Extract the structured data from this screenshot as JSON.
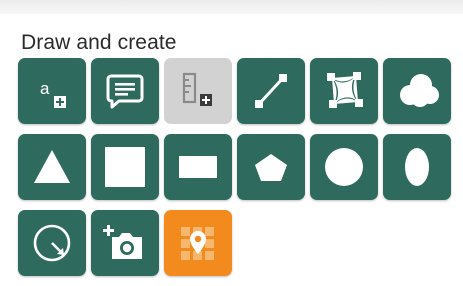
{
  "panel": {
    "title": "Draw and create"
  },
  "colors": {
    "tile": "#2e6b5e",
    "tile_disabled": "#d2d2d2",
    "tile_active": "#f28a1e",
    "icon": "#ffffff"
  },
  "tools": [
    {
      "name": "text-tool",
      "icon": "text-plus-icon",
      "glyph": "a",
      "state": "enabled"
    },
    {
      "name": "callout-tool",
      "icon": "speech-bubble-icon",
      "state": "enabled"
    },
    {
      "name": "ruler-tool",
      "icon": "ruler-plus-icon",
      "state": "disabled"
    },
    {
      "name": "line-tool",
      "icon": "line-segment-icon",
      "state": "enabled"
    },
    {
      "name": "polygon-tool",
      "icon": "freeform-polygon-icon",
      "state": "enabled"
    },
    {
      "name": "cloud-tool",
      "icon": "cloud-icon",
      "state": "enabled"
    },
    {
      "name": "triangle-tool",
      "icon": "triangle-icon",
      "state": "enabled"
    },
    {
      "name": "square-tool",
      "icon": "square-icon",
      "state": "enabled"
    },
    {
      "name": "rectangle-tool",
      "icon": "rectangle-icon",
      "state": "enabled"
    },
    {
      "name": "pentagon-tool",
      "icon": "pentagon-icon",
      "state": "enabled"
    },
    {
      "name": "circle-tool",
      "icon": "circle-icon",
      "state": "enabled"
    },
    {
      "name": "ellipse-tool",
      "icon": "ellipse-icon",
      "state": "enabled"
    },
    {
      "name": "radius-tool",
      "icon": "circle-radius-icon",
      "state": "enabled"
    },
    {
      "name": "add-photo-tool",
      "icon": "camera-plus-icon",
      "state": "enabled"
    },
    {
      "name": "grid-location-tool",
      "icon": "grid-pin-icon",
      "state": "active"
    }
  ]
}
